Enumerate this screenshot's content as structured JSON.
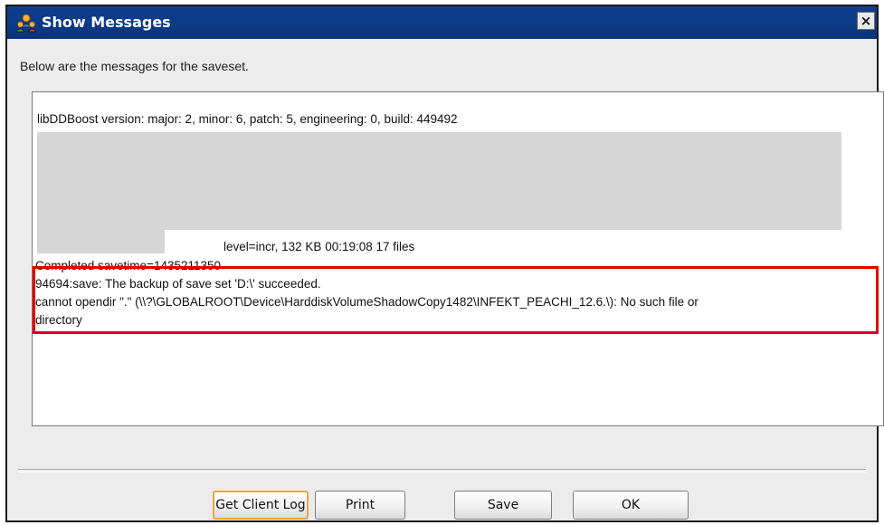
{
  "window": {
    "title": "Show Messages",
    "icon": "network-users-icon",
    "close_label": "×"
  },
  "intro_text": "Below are the messages for the saveset.",
  "messages": {
    "line1": "libDDBoost version: major: 2, minor: 6, patch: 5, engineering: 0, build: 449492",
    "line_partial": "level=incr,   132 KB 00:19:08    17 files",
    "line_completed": "Completed savetime=1435211350",
    "line_success": "94694:save: The backup of save set 'D:\\' succeeded.",
    "line_error_1": "cannot opendir \".\" (\\\\?\\GLOBALROOT\\Device\\HarddiskVolumeShadowCopy1482\\INFEKT_PEACHI_12.6.\\): No such file or",
    "line_error_2": "directory"
  },
  "buttons": {
    "get_client_log": "Get Client Log",
    "print": "Print",
    "save": "Save",
    "ok": "OK"
  },
  "colors": {
    "titlebar": "#0b3a86",
    "highlight_border": "#e10000",
    "focus_border": "#e8a742"
  }
}
